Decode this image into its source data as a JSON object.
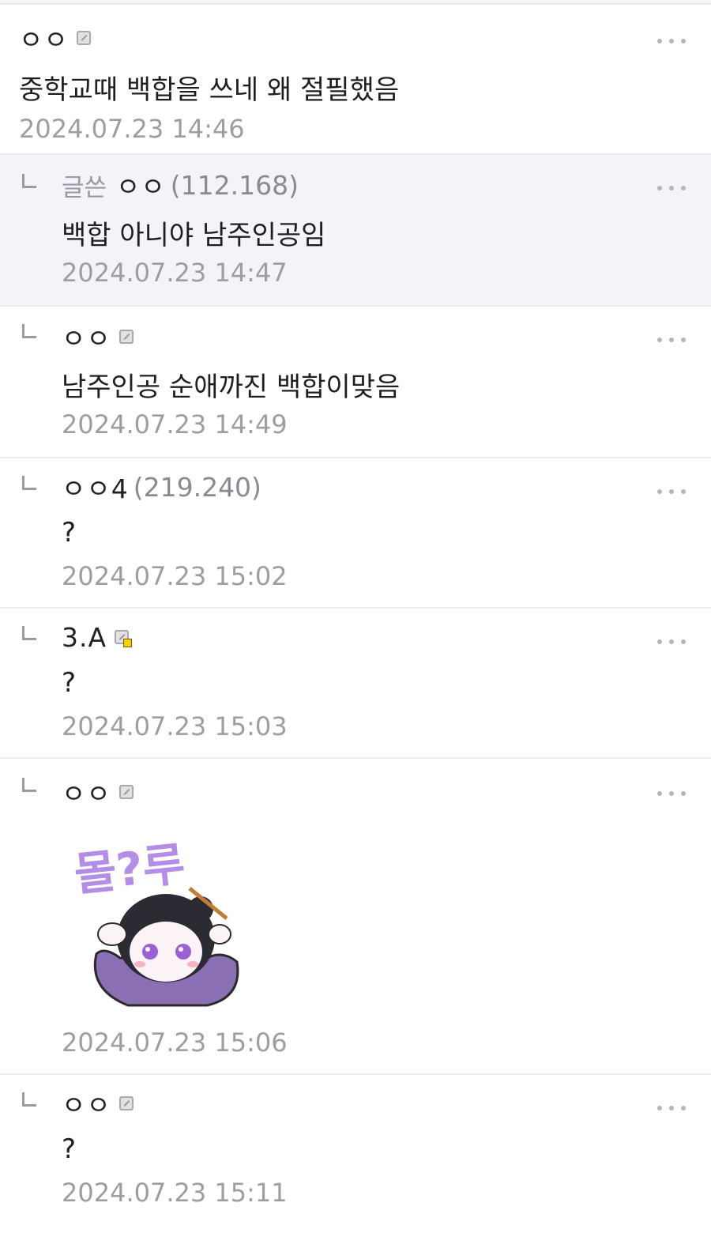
{
  "comments": [
    {
      "name": "ㅇㅇ",
      "text": "중학교때 백합을 쓰네 왜 절필했음",
      "date": "2024.07.23 14:46"
    },
    {
      "writer_tag": "글쓴",
      "name": "ㅇㅇ",
      "ip": "(112.168)",
      "text": "백합 아니야 남주인공임",
      "date": "2024.07.23 14:47"
    },
    {
      "name": "ㅇㅇ",
      "text": "남주인공 순애까진 백합이맞음",
      "date": "2024.07.23 14:49"
    },
    {
      "name": "ㅇㅇ4",
      "ip": "(219.240)",
      "text": "?",
      "date": "2024.07.23 15:02"
    },
    {
      "name": "3.A",
      "text": "?",
      "date": "2024.07.23 15:03"
    },
    {
      "name": "ㅇㅇ",
      "sticker_text": "몰?루",
      "date": "2024.07.23 15:06"
    },
    {
      "name": "ㅇㅇ",
      "text": "?",
      "date": "2024.07.23 15:11"
    }
  ],
  "icons": {
    "fixed_nick": "fixed-nick-icon",
    "more": "more-dots-icon",
    "reply": "reply-arrow-icon"
  },
  "colors": {
    "highlight_bg": "#f3f4f9",
    "meta_gray": "#9d9da3",
    "sticker_purple": "#b48de6"
  }
}
